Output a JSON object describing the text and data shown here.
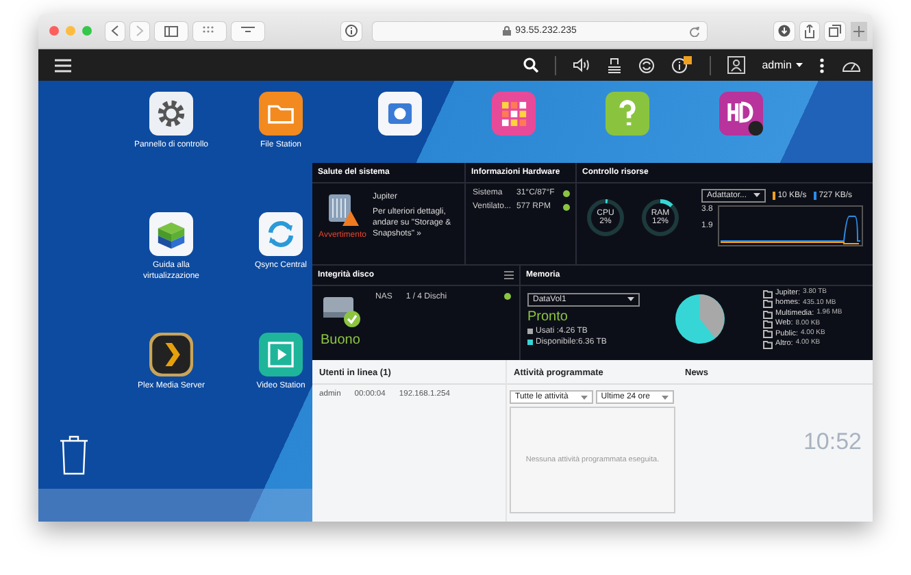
{
  "browser": {
    "url": "93.55.232.235"
  },
  "topbar": {
    "user": "admin"
  },
  "desktop_icons": [
    {
      "label": "Pannello di controllo",
      "kind": "gear"
    },
    {
      "label": "File Station",
      "kind": "folder"
    },
    {
      "label": "Guida alla virtualizzazione",
      "kind": "cube"
    },
    {
      "label": "Qsync Central",
      "kind": "sync"
    },
    {
      "label": "Plex Media Server",
      "kind": "plex"
    },
    {
      "label": "Video Station",
      "kind": "video"
    }
  ],
  "covered_icons": [
    {
      "kind": "storage"
    },
    {
      "kind": "apps"
    },
    {
      "kind": "help"
    },
    {
      "kind": "hd"
    }
  ],
  "system_health": {
    "title": "Salute del sistema",
    "status": "Avvertimento",
    "device": "Jupiter",
    "message": "Per ulteriori dettagli, andare su \"Storage & Snapshots\" »"
  },
  "hardware": {
    "title": "Informazioni Hardware",
    "rows": [
      {
        "label": "Sistema",
        "value": "31°C/87°F",
        "ok": true
      },
      {
        "label": "Ventilato...",
        "value": "577 RPM",
        "ok": true
      }
    ]
  },
  "resources": {
    "title": "Controllo risorse",
    "gauges": [
      {
        "label": "CPU",
        "value": "2%",
        "level": 0.02
      },
      {
        "label": "RAM",
        "value": "12%",
        "level": 0.12
      }
    ],
    "adapter": "Adattator...",
    "upload": "10 KB/s",
    "download": "727 KB/s",
    "y_labels": [
      "3.8",
      "1.9"
    ]
  },
  "disk": {
    "title": "Integrità disco",
    "status": "Buono",
    "name": "NAS",
    "disks": "1 / 4 Dischi",
    "ok": true
  },
  "storage": {
    "title": "Memoria",
    "volume": "DataVol1",
    "status": "Pronto",
    "used": "Usati :4.26 TB",
    "free": "Disponibile:6.36 TB",
    "folders": [
      {
        "name": "Jupiter:",
        "size": "3.80 TB"
      },
      {
        "name": "homes:",
        "size": "435.10 MB"
      },
      {
        "name": "Multimedia:",
        "size": "1.96 MB"
      },
      {
        "name": "Web:",
        "size": "8.00 KB"
      },
      {
        "name": "Public:",
        "size": "4.00 KB"
      },
      {
        "name": "Altro:",
        "size": "4.00 KB"
      }
    ]
  },
  "online_users": {
    "title": "Utenti in linea (1)",
    "rows": [
      {
        "user": "admin",
        "time": "00:00:04",
        "ip": "192.168.1.254"
      }
    ]
  },
  "scheduled": {
    "title": "Attività programmate",
    "filter": "Tutte le attività",
    "range": "Ultime 24 ore",
    "empty": "Nessuna attività programmata eseguita."
  },
  "news": {
    "title": "News"
  },
  "clock": "10:52"
}
